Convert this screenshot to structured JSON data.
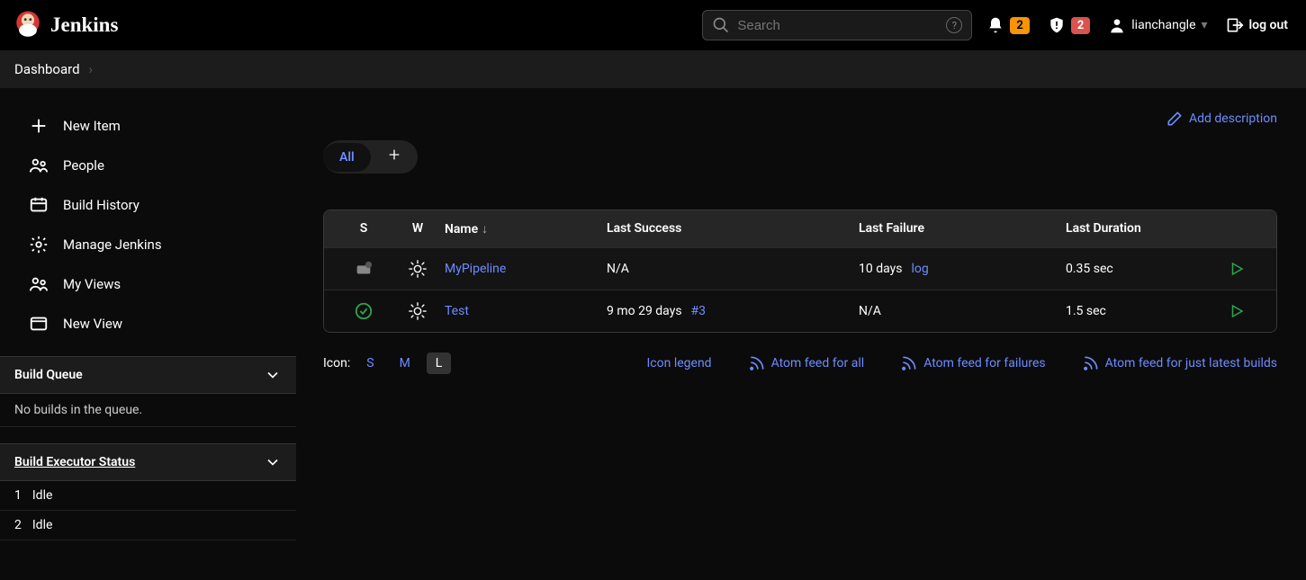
{
  "header": {
    "app_name": "Jenkins",
    "search_placeholder": "Search",
    "notif_count": "2",
    "alert_count": "2",
    "username": "lianchangle",
    "logout_label": "log out"
  },
  "breadcrumb": {
    "root": "Dashboard"
  },
  "sidebar": {
    "items": [
      {
        "label": "New Item"
      },
      {
        "label": "People"
      },
      {
        "label": "Build History"
      },
      {
        "label": "Manage Jenkins"
      },
      {
        "label": "My Views"
      },
      {
        "label": "New View"
      }
    ],
    "build_queue": {
      "title": "Build Queue",
      "empty_text": "No builds in the queue."
    },
    "executor": {
      "title": "Build Executor Status",
      "rows": [
        {
          "num": "1",
          "state": "Idle"
        },
        {
          "num": "2",
          "state": "Idle"
        }
      ]
    }
  },
  "main": {
    "add_description": "Add description",
    "tabs": {
      "all": "All"
    },
    "columns": {
      "s": "S",
      "w": "W",
      "name": "Name",
      "last_success": "Last Success",
      "last_failure": "Last Failure",
      "last_duration": "Last Duration"
    },
    "jobs": [
      {
        "name": "MyPipeline",
        "last_success": "N/A",
        "success_link": "",
        "last_failure": "10 days",
        "failure_link": "log",
        "last_duration": "0.35 sec"
      },
      {
        "name": "Test",
        "last_success": "9 mo 29 days",
        "success_link": "#3",
        "last_failure": "N/A",
        "failure_link": "",
        "last_duration": "1.5 sec"
      }
    ],
    "footer": {
      "icon_label": "Icon:",
      "s": "S",
      "m": "M",
      "l": "L",
      "icon_legend": "Icon legend",
      "feed_all": "Atom feed for all",
      "feed_failures": "Atom feed for failures",
      "feed_latest": "Atom feed for just latest builds"
    }
  }
}
